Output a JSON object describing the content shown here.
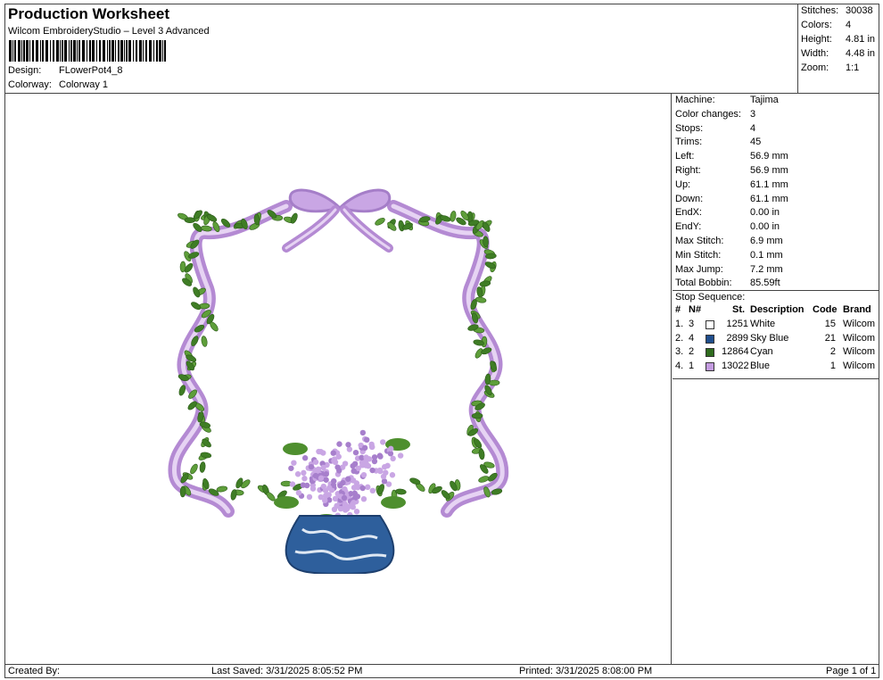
{
  "header": {
    "title": "Production Worksheet",
    "subtitle": "Wilcom EmbroideryStudio – Level 3 Advanced",
    "design_label": "Design:",
    "design_value": "FLowerPot4_8",
    "colorway_label": "Colorway:",
    "colorway_value": "Colorway 1"
  },
  "summary": [
    {
      "label": "Stitches:",
      "value": "30038"
    },
    {
      "label": "Colors:",
      "value": "4"
    },
    {
      "label": "Height:",
      "value": "4.81 in"
    },
    {
      "label": "Width:",
      "value": "4.48 in"
    },
    {
      "label": "Zoom:",
      "value": "1:1"
    }
  ],
  "info": [
    {
      "label": "Machine:",
      "value": "Tajima"
    },
    {
      "label": "Color changes:",
      "value": "3"
    },
    {
      "label": "Stops:",
      "value": "4"
    },
    {
      "label": "Trims:",
      "value": "45"
    },
    {
      "label": "Left:",
      "value": "56.9 mm"
    },
    {
      "label": "Right:",
      "value": "56.9 mm"
    },
    {
      "label": "Up:",
      "value": "61.1 mm"
    },
    {
      "label": "Down:",
      "value": "61.1 mm"
    },
    {
      "label": "EndX:",
      "value": "0.00 in"
    },
    {
      "label": "EndY:",
      "value": "0.00 in"
    },
    {
      "label": "Max Stitch:",
      "value": "6.9 mm"
    },
    {
      "label": "Min Stitch:",
      "value": "0.1 mm"
    },
    {
      "label": "Max Jump:",
      "value": "7.2 mm"
    },
    {
      "label": "Total Bobbin:",
      "value": "85.59ft"
    }
  ],
  "stop_sequence": {
    "title": "Stop Sequence:",
    "headers": {
      "num": "#",
      "n": "N#",
      "st": "St.",
      "desc": "Description",
      "code": "Code",
      "brand": "Brand"
    },
    "rows": [
      {
        "num": "1.",
        "n": "3",
        "color": "#ffffff",
        "st": "1251",
        "desc": "White",
        "code": "15",
        "brand": "Wilcom"
      },
      {
        "num": "2.",
        "n": "4",
        "color": "#1f4e8c",
        "st": "2899",
        "desc": "Sky Blue",
        "code": "21",
        "brand": "Wilcom"
      },
      {
        "num": "3.",
        "n": "2",
        "color": "#2f6b1e",
        "st": "12864",
        "desc": "Cyan",
        "code": "2",
        "brand": "Wilcom"
      },
      {
        "num": "4.",
        "n": "1",
        "color": "#c39be0",
        "st": "13022",
        "desc": "Blue",
        "code": "1",
        "brand": "Wilcom"
      }
    ]
  },
  "footer": {
    "created": "Created By:",
    "saved": "Last Saved: 3/31/2025 8:05:52 PM",
    "printed": "Printed: 3/31/2025 8:08:00 PM",
    "page": "Page 1 of 1"
  },
  "colors": {
    "leaf": "#4e8f2e",
    "ribbon": "#c7a3e0",
    "vase": "#2e5f9c",
    "hydrangea": "#c9a6e4"
  }
}
